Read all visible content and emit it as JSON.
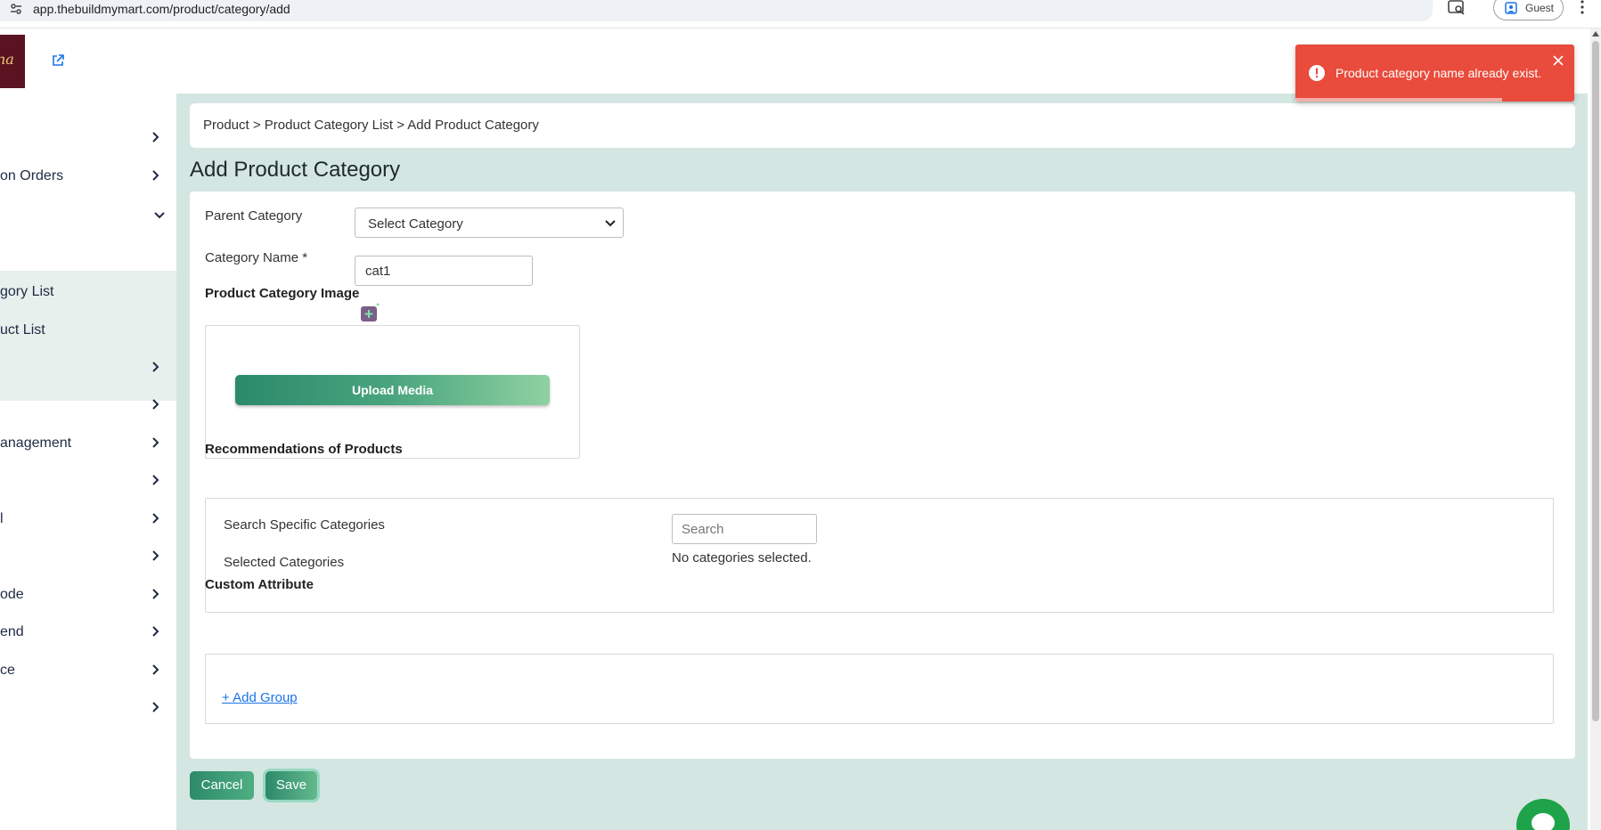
{
  "browser": {
    "url": "app.thebuildmymart.com/product/category/add",
    "profile": "Guest"
  },
  "sidebar": {
    "items": [
      {
        "label": "",
        "chevron": "right"
      },
      {
        "label": "on Orders",
        "chevron": "right"
      },
      {
        "label": "",
        "chevron": "down"
      },
      {
        "label": "gory List",
        "chevron": ""
      },
      {
        "label": "uct List",
        "chevron": ""
      },
      {
        "label": "",
        "chevron": "right"
      },
      {
        "label": "",
        "chevron": "right"
      },
      {
        "label": "anagement",
        "chevron": "right"
      },
      {
        "label": "",
        "chevron": "right"
      },
      {
        "label": "l",
        "chevron": "right"
      },
      {
        "label": "",
        "chevron": "right"
      },
      {
        "label": "ode",
        "chevron": "right"
      },
      {
        "label": "end",
        "chevron": "right"
      },
      {
        "label": "ce",
        "chevron": "right"
      },
      {
        "label": "",
        "chevron": "right"
      }
    ]
  },
  "breadcrumb": "Product > Product Category List > Add Product Category",
  "page_title": "Add Product Category",
  "form": {
    "parent_category_label": "Parent Category",
    "parent_category_value": "Select Category",
    "category_name_label": "Category Name *",
    "category_name_value": "cat1",
    "image_label": "Product Category Image",
    "upload_label": "Upload Media",
    "recommendations_label": "Recommendations of Products",
    "search_label": "Search Specific Categories",
    "search_placeholder": "Search",
    "selected_label": "Selected Categories",
    "selected_empty": "No categories selected.",
    "custom_attribute_label": "Custom Attribute",
    "add_group_label": "+ Add Group"
  },
  "actions": {
    "cancel": "Cancel",
    "save": "Save"
  },
  "toast": {
    "message": "Product category name already exist.",
    "progress": 0.74,
    "color": "#e94b3c"
  },
  "colors": {
    "accent": "#2c8a6a",
    "main_bg": "#d4e6e1",
    "link": "#1a73e8"
  }
}
